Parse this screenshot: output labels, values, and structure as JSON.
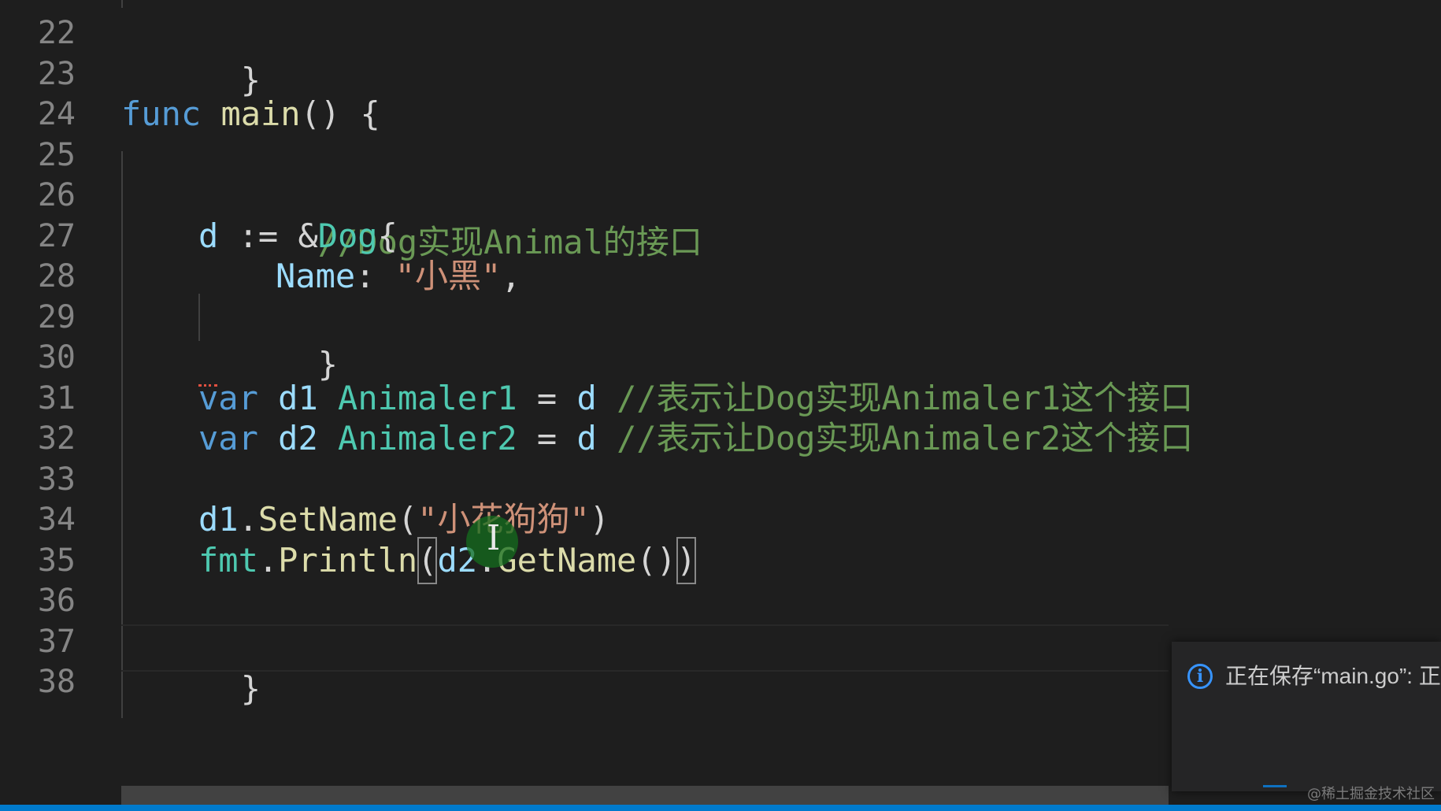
{
  "editor": {
    "line_numbers": [
      "22",
      "23",
      "24",
      "25",
      "26",
      "27",
      "28",
      "29",
      "30",
      "31",
      "32",
      "33",
      "34",
      "35",
      "36",
      "37",
      "38"
    ],
    "lines": {
      "l22": {
        "brace": "}"
      },
      "l24": {
        "kw": "func",
        "name": "main",
        "rest": "() {"
      },
      "l26": {
        "comment": "//Dog实现Animal的接口"
      },
      "l27": {
        "var": "d",
        "op": " := &",
        "type": "Dog",
        "brace": "{"
      },
      "l28": {
        "field": "Name",
        "colon": ": ",
        "str": "\"小黑\"",
        "comma": ","
      },
      "l29": {
        "brace": "}"
      },
      "l31": {
        "kw": "var",
        "name": "d1",
        "type": "Animaler1",
        "op": " = ",
        "val": "d",
        "comment": "//表示让Dog实现Animaler1这个接口"
      },
      "l32": {
        "kw": "var",
        "name": "d2",
        "type": "Animaler2",
        "op": " = ",
        "val": "d",
        "comment": "//表示让Dog实现Animaler2这个接口"
      },
      "l34": {
        "obj": "d1",
        "dot": ".",
        "method": "SetName",
        "open": "(",
        "str": "\"小花狗狗\"",
        "close": ")"
      },
      "l35": {
        "pkg": "fmt",
        "dot": ".",
        "method": "Println",
        "open": "(",
        "obj": "d2",
        "dot2": ".",
        "method2": "GetName",
        "parens": "()",
        "close": ")"
      },
      "l37": {
        "brace": "}"
      }
    }
  },
  "notification": {
    "icon": "info-icon",
    "message": "正在保存“main.go”: 正"
  },
  "watermark": "@稀土掘金技术社区",
  "colors": {
    "background": "#1e1e1e",
    "keyword": "#569cd6",
    "function": "#dcdcaa",
    "variable": "#9cdcfe",
    "string": "#ce9178",
    "comment": "#6a9955",
    "status_bar": "#007acc"
  }
}
